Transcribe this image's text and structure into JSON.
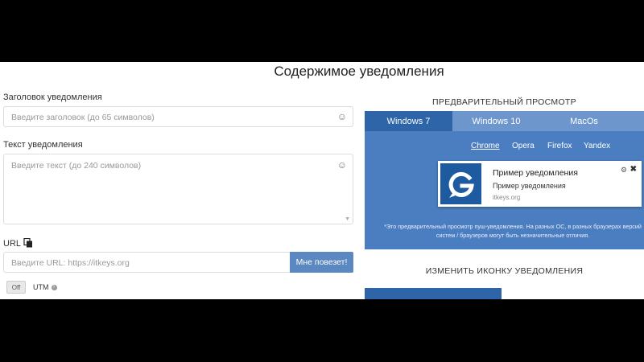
{
  "page": {
    "title": "Содержимое уведомления"
  },
  "form": {
    "title_label": "Заголовок уведомления",
    "title_placeholder": "Введите заголовок (до 65 символов)",
    "text_label": "Текст уведомления",
    "text_placeholder": "Введите текст (до 240 символов)",
    "url_label": "URL",
    "url_placeholder": "Введите URL: https://itkeys.org",
    "lucky_button": "Мне повезет!",
    "toggle_label": "Off",
    "utm_label": "UTM",
    "utm_info": "i",
    "emoji_icon": "☺",
    "scroll_arrow": "▼"
  },
  "preview": {
    "heading": "ПРЕДВАРИТЕЛЬНЫЙ ПРОСМОТР",
    "os_tabs": [
      "Windows 7",
      "Windows 10",
      "MacOs"
    ],
    "active_tab": 0,
    "browsers": [
      "Chrome",
      "Opera",
      "Firefox",
      "Yandex"
    ],
    "active_browser": 0,
    "notification": {
      "title": "Пример уведомления",
      "body": "Пример уведомления",
      "site": "itkeys.org",
      "gear": "⚙",
      "close": "✖"
    },
    "note": "*Это предварительный просмотр пуш-уведомления. На разных ОС, в разных браузерах версий систем / браузеров могут быть незначительные отличия."
  },
  "icon_section": {
    "heading": "ИЗМЕНИТЬ ИКОНКУ УВЕДОМЛЕНИЯ"
  },
  "colors": {
    "accent": "#4a7ec0",
    "tab_active": "#2e64a8",
    "button": "#5b88c0"
  }
}
